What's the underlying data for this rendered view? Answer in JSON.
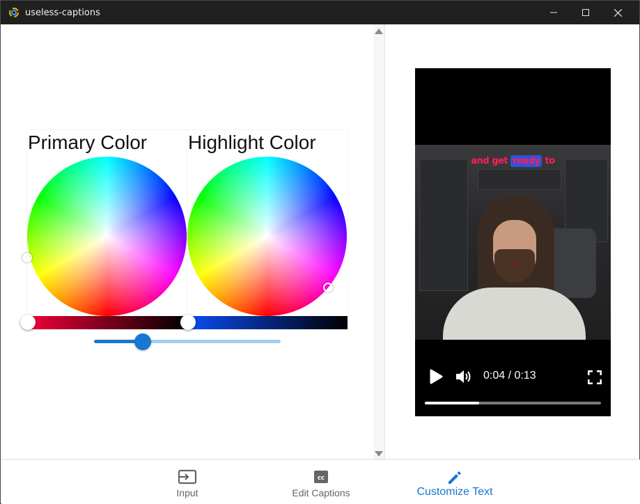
{
  "window": {
    "title": "useless-captions"
  },
  "pickers": {
    "primary": {
      "title": "Primary Color",
      "brightness_bar_colors": [
        "#f2003a",
        "#000000"
      ]
    },
    "highlight": {
      "title": "Highlight Color",
      "brightness_bar_colors": [
        "#0a4cf5",
        "#000000"
      ]
    }
  },
  "size_slider": {
    "value_fraction": 0.26
  },
  "video": {
    "caption_before": "and get ",
    "caption_highlight": "ready",
    "caption_after": " to",
    "time_display": "0:04 / 0:13",
    "progress_fraction": 0.31,
    "caption_color": "#ff1f55",
    "highlight_color": "#2f52d9"
  },
  "nav": {
    "items": [
      {
        "label": "Input",
        "icon": "input-icon"
      },
      {
        "label": "Edit Captions",
        "icon": "closed-caption-icon"
      },
      {
        "label": "Customize Text",
        "icon": "pencil-icon"
      }
    ],
    "active_index": 2
  },
  "colors": {
    "accent": "#1976d2",
    "titlebar": "#202020"
  }
}
